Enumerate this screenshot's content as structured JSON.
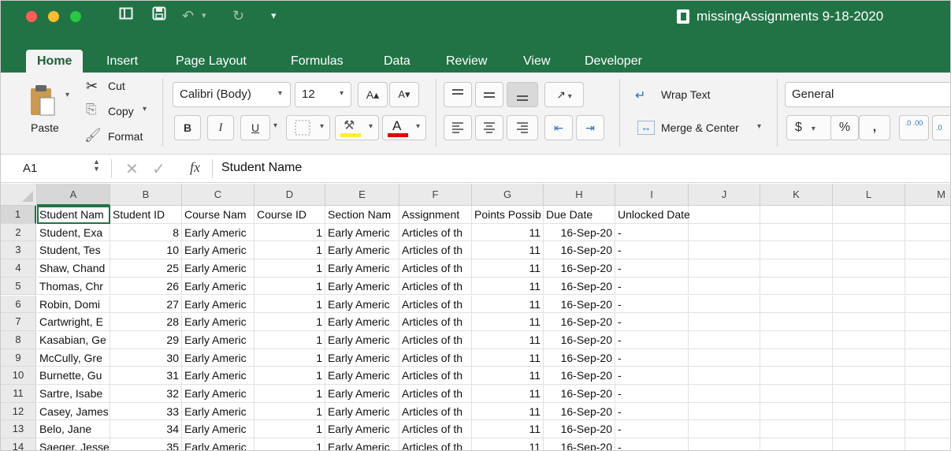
{
  "window": {
    "title": "missingAssignments 9-18-2020",
    "colors": {
      "accent": "#217346",
      "traffic_close": "#fe5f57",
      "traffic_min": "#febc2e",
      "traffic_max": "#28c840",
      "selection": "#217346"
    }
  },
  "quick_access": {
    "icons": [
      "sidebar-toggle-icon",
      "save-icon",
      "undo-icon",
      "redo-icon",
      "customize-toolbar-icon"
    ]
  },
  "tabs": [
    "Home",
    "Insert",
    "Page Layout",
    "Formulas",
    "Data",
    "Review",
    "View",
    "Developer"
  ],
  "active_tab": "Home",
  "ribbon": {
    "clipboard": {
      "paste": "Paste",
      "cut": "Cut",
      "copy": "Copy",
      "format": "Format"
    },
    "font": {
      "name": "Calibri (Body)",
      "size": "12",
      "bold": "B",
      "italic": "I",
      "underline": "U",
      "font_color": "A",
      "highlight_color": "#ffeb3b",
      "text_color": "#e00000"
    },
    "alignment": {
      "wrap_text": "Wrap Text",
      "merge_center": "Merge & Center"
    },
    "number": {
      "format": "General",
      "currency": "$",
      "percent": "%",
      "comma": ",",
      "inc_decimal": ".0 .00",
      "dec_decimal": ".0"
    }
  },
  "formula_bar": {
    "cell_ref": "A1",
    "fx": "fx",
    "content": "Student Name"
  },
  "columns": [
    "A",
    "B",
    "C",
    "D",
    "E",
    "F",
    "G",
    "H",
    "I",
    "J",
    "K",
    "L",
    "M"
  ],
  "row_numbers": [
    "1",
    "2",
    "3",
    "4",
    "5",
    "6",
    "7",
    "8",
    "9",
    "10",
    "11",
    "12",
    "13",
    "14"
  ],
  "header_row": [
    "Student Nam",
    "Student ID",
    "Course Nam",
    "Course ID",
    "Section Nam",
    "Assignment",
    "Points Possib",
    "Due Date",
    "Unlocked Date"
  ],
  "rows": [
    [
      "Student, Exa",
      "8",
      "Early Americ",
      "1",
      "Early Americ",
      "Articles of th",
      "11",
      "16-Sep-20",
      "-"
    ],
    [
      "Student, Tes",
      "10",
      "Early Americ",
      "1",
      "Early Americ",
      "Articles of th",
      "11",
      "16-Sep-20",
      "-"
    ],
    [
      "Shaw, Chand",
      "25",
      "Early Americ",
      "1",
      "Early Americ",
      "Articles of th",
      "11",
      "16-Sep-20",
      "-"
    ],
    [
      "Thomas, Chr",
      "26",
      "Early Americ",
      "1",
      "Early Americ",
      "Articles of th",
      "11",
      "16-Sep-20",
      "-"
    ],
    [
      "Robin, Domi",
      "27",
      "Early Americ",
      "1",
      "Early Americ",
      "Articles of th",
      "11",
      "16-Sep-20",
      "-"
    ],
    [
      "Cartwright, E",
      "28",
      "Early Americ",
      "1",
      "Early Americ",
      "Articles of th",
      "11",
      "16-Sep-20",
      "-"
    ],
    [
      "Kasabian, Ge",
      "29",
      "Early Americ",
      "1",
      "Early Americ",
      "Articles of th",
      "11",
      "16-Sep-20",
      "-"
    ],
    [
      "McCully, Gre",
      "30",
      "Early Americ",
      "1",
      "Early Americ",
      "Articles of th",
      "11",
      "16-Sep-20",
      "-"
    ],
    [
      "Burnette, Gu",
      "31",
      "Early Americ",
      "1",
      "Early Americ",
      "Articles of th",
      "11",
      "16-Sep-20",
      "-"
    ],
    [
      "Sartre, Isabe",
      "32",
      "Early Americ",
      "1",
      "Early Americ",
      "Articles of th",
      "11",
      "16-Sep-20",
      "-"
    ],
    [
      "Casey, James",
      "33",
      "Early Americ",
      "1",
      "Early Americ",
      "Articles of th",
      "11",
      "16-Sep-20",
      "-"
    ],
    [
      "Belo, Jane",
      "34",
      "Early Americ",
      "1",
      "Early Americ",
      "Articles of th",
      "11",
      "16-Sep-20",
      "-"
    ],
    [
      "Saeger, Jesse",
      "35",
      "Early Americ",
      "1",
      "Early Americ",
      "Articles of th",
      "11",
      "16-Sep-20",
      "-"
    ]
  ]
}
